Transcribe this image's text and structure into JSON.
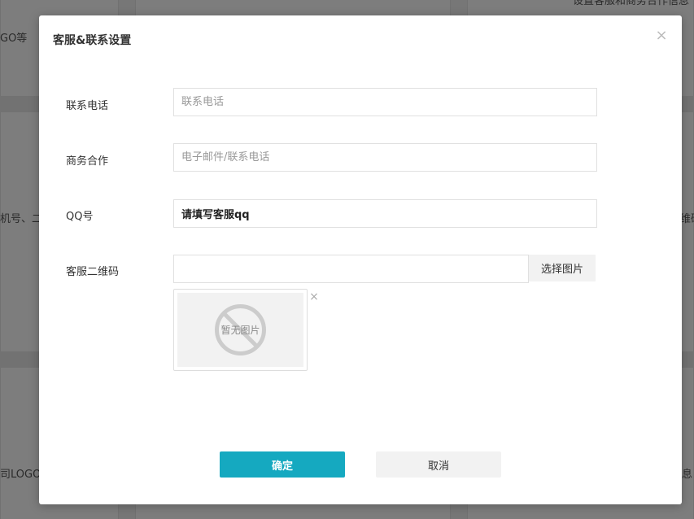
{
  "background": {
    "snippets": [
      "GO等",
      "机号、二",
      "维码",
      "司LOGO",
      "息",
      "设置客服和商务合作信息"
    ]
  },
  "modal": {
    "title": "客服&联系设置",
    "close_glyph": "×"
  },
  "form": {
    "phone": {
      "label": "联系电话",
      "placeholder": "联系电话",
      "value": ""
    },
    "business": {
      "label": "商务合作",
      "placeholder": "电子邮件/联系电话",
      "value": ""
    },
    "qq": {
      "label": "QQ号",
      "placeholder": "",
      "value": "请填写客服qq"
    },
    "qrcode": {
      "label": "客服二维码",
      "file_value": "",
      "choose_label": "选择图片",
      "preview_text": "暂无图片",
      "remove_glyph": "×"
    }
  },
  "actions": {
    "confirm_label": "确定",
    "cancel_label": "取消"
  },
  "colors": {
    "primary": "#15a9c0",
    "overlay": "rgba(0,0,0,0.5)"
  },
  "icons": {
    "close": "close-icon",
    "remove": "remove-image-icon",
    "no_image": "no-image-icon"
  }
}
